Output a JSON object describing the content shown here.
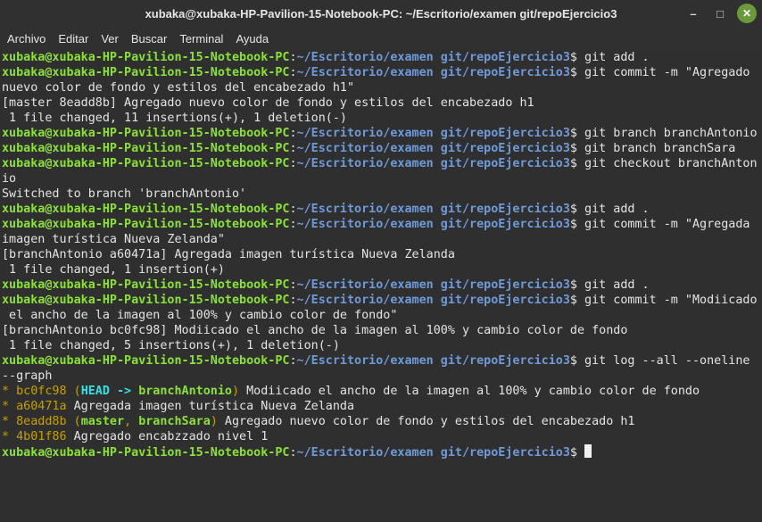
{
  "window": {
    "title": "xubaka@xubaka-HP-Pavilion-15-Notebook-PC: ~/Escritorio/examen git/repoEjercicio3",
    "controls": [
      "minimize-icon",
      "maximize-icon",
      "close-icon"
    ]
  },
  "menu": [
    "Archivo",
    "Editar",
    "Ver",
    "Buscar",
    "Terminal",
    "Ayuda"
  ],
  "prompt": {
    "user": "xubaka@xubaka-HP-Pavilion-15-Notebook-PC",
    "path": "~/Escritorio/examen git/repoEjercicio3"
  },
  "lines": [
    {
      "type": "prompt",
      "cmd": " git add ."
    },
    {
      "type": "prompt",
      "cmd": " git commit -m \"Agregado"
    },
    {
      "type": "text",
      "text": "nuevo color de fondo y estilos del encabezado h1\""
    },
    {
      "type": "text",
      "text": "[master 8eadd8b] Agregado nuevo color de fondo y estilos del encabezado h1"
    },
    {
      "type": "text",
      "text": " 1 file changed, 11 insertions(+), 1 deletion(-)"
    },
    {
      "type": "prompt",
      "cmd": " git branch branchAntonio"
    },
    {
      "type": "prompt",
      "cmd": " git branch branchSara"
    },
    {
      "type": "prompt",
      "cmd": " git checkout branchAnton"
    },
    {
      "type": "text",
      "text": "io"
    },
    {
      "type": "text",
      "text": "Switched to branch 'branchAntonio'"
    },
    {
      "type": "prompt",
      "cmd": " git add ."
    },
    {
      "type": "prompt",
      "cmd": " git commit -m \"Agregada"
    },
    {
      "type": "text",
      "text": "imagen turística Nueva Zelanda\""
    },
    {
      "type": "text",
      "text": "[branchAntonio a60471a] Agregada imagen turística Nueva Zelanda"
    },
    {
      "type": "text",
      "text": " 1 file changed, 1 insertion(+)"
    },
    {
      "type": "prompt",
      "cmd": " git add ."
    },
    {
      "type": "prompt",
      "cmd": " git commit -m \"Modiicado"
    },
    {
      "type": "text",
      "text": " el ancho de la imagen al 100% y cambio color de fondo\""
    },
    {
      "type": "text",
      "text": "[branchAntonio bc0fc98] Modiicado el ancho de la imagen al 100% y cambio color de fondo"
    },
    {
      "type": "text",
      "text": " 1 file changed, 5 insertions(+), 1 deletion(-)"
    },
    {
      "type": "prompt",
      "cmd": " git log --all --oneline"
    },
    {
      "type": "text",
      "text": "--graph"
    },
    {
      "type": "log",
      "hash": "bc0fc98",
      "refs": [
        {
          "t": "(",
          "c": "paren"
        },
        {
          "t": "HEAD -> ",
          "c": "head"
        },
        {
          "t": "branchAntonio",
          "c": "br"
        },
        {
          "t": ")",
          "c": "paren"
        }
      ],
      "msg": " Modiicado el ancho de la imagen al 100% y cambio color de fondo"
    },
    {
      "type": "log",
      "hash": "a60471a",
      "refs": [],
      "msg": "Agregada imagen turística Nueva Zelanda"
    },
    {
      "type": "log",
      "hash": "8eadd8b",
      "refs": [
        {
          "t": "(",
          "c": "paren"
        },
        {
          "t": "master",
          "c": "br"
        },
        {
          "t": ", ",
          "c": "paren"
        },
        {
          "t": "branchSara",
          "c": "br"
        },
        {
          "t": ")",
          "c": "paren"
        }
      ],
      "msg": " Agregado nuevo color de fondo y estilos del encabezado h1"
    },
    {
      "type": "log",
      "hash": "4b01f86",
      "refs": [],
      "msg": "Agregado encabzzado nivel 1"
    },
    {
      "type": "prompt",
      "cmd": " ",
      "cursor": true
    }
  ],
  "colors": {
    "user": "#8ae234",
    "path": "#6f9ad8",
    "hash": "#c4a000",
    "background": "#2f2f2f"
  }
}
